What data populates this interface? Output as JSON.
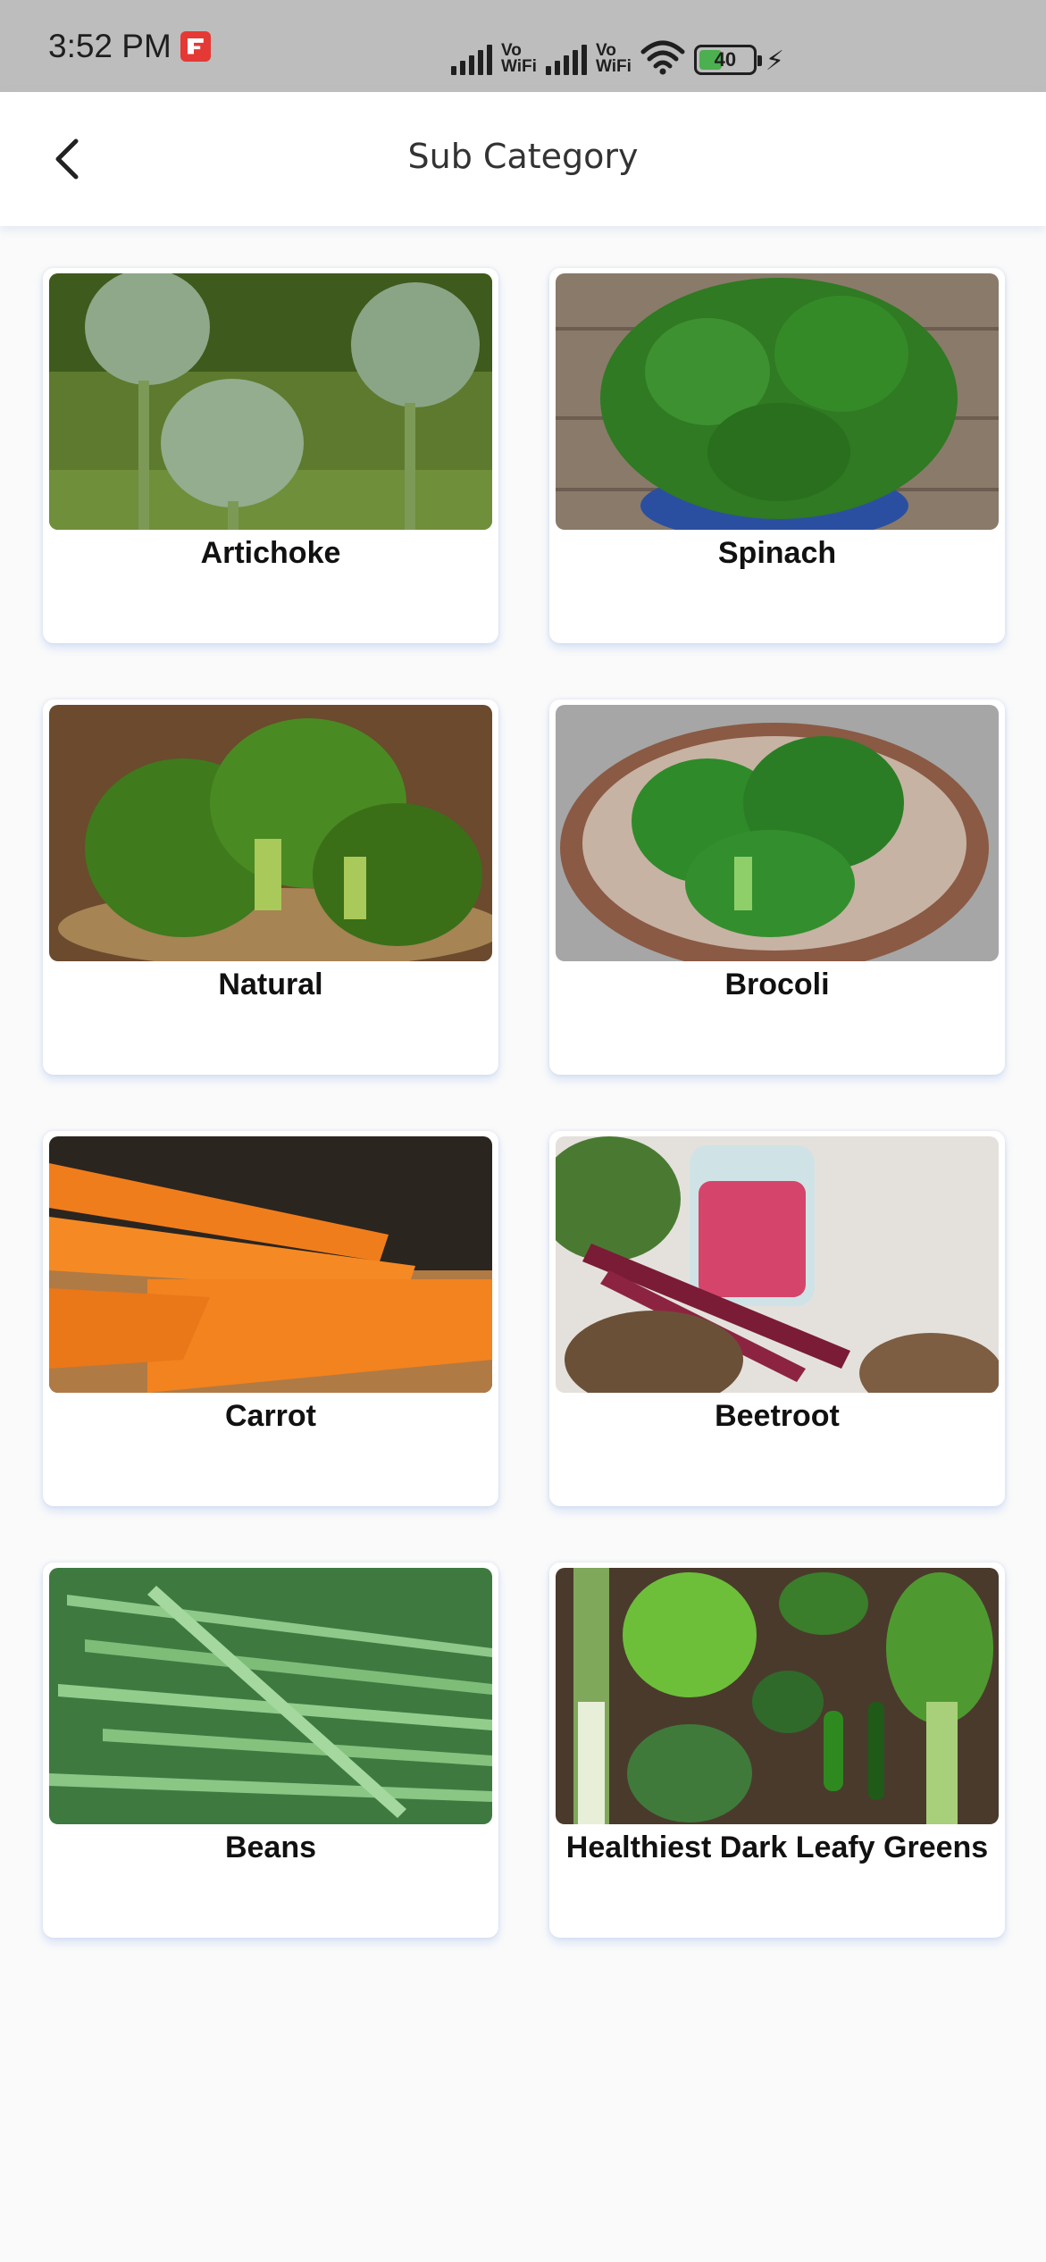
{
  "status_bar": {
    "time": "3:52 PM",
    "vowifi_top": "Vo",
    "vowifi_bottom": "WiFi",
    "battery_level": "40"
  },
  "header": {
    "title": "Sub Category"
  },
  "categories": [
    {
      "label": "Artichoke"
    },
    {
      "label": "Spinach"
    },
    {
      "label": "Natural"
    },
    {
      "label": "Brocoli"
    },
    {
      "label": "Carrot"
    },
    {
      "label": "Beetroot"
    },
    {
      "label": "Beans"
    },
    {
      "label": "Healthiest Dark Leafy Greens"
    }
  ],
  "colors": {
    "status_bar_bg": "#bdbdbd",
    "page_bg": "#fafafa",
    "card_bg": "#ffffff",
    "battery_green": "#4caf50"
  }
}
